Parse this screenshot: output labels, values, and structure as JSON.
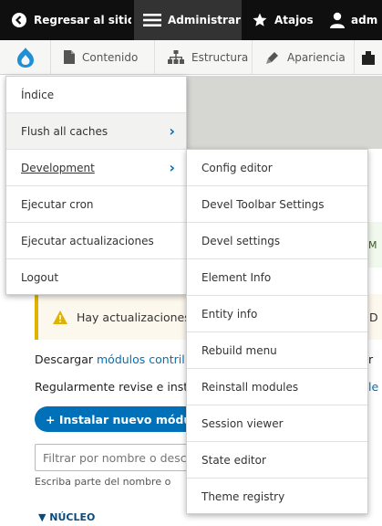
{
  "toolbar": {
    "back_label": "Regresar al sitio",
    "admin_label": "Administrar",
    "shortcuts_label": "Atajos",
    "user_label": "adm"
  },
  "tray": {
    "contenido": "Contenido",
    "estructura": "Estructura",
    "apariencia": "Apariencia"
  },
  "menu": {
    "items": [
      {
        "label": "Índice"
      },
      {
        "label": "Flush all caches"
      },
      {
        "label": "Development"
      },
      {
        "label": "Ejecutar cron"
      },
      {
        "label": "Ejecutar actualizaciones"
      },
      {
        "label": "Logout"
      }
    ]
  },
  "submenu": {
    "items": [
      {
        "label": "Config editor"
      },
      {
        "label": "Devel Toolbar Settings"
      },
      {
        "label": "Devel settings"
      },
      {
        "label": "Element Info"
      },
      {
        "label": "Entity info"
      },
      {
        "label": "Rebuild menu"
      },
      {
        "label": "Reinstall modules"
      },
      {
        "label": "Session viewer"
      },
      {
        "label": "State editor"
      },
      {
        "label": "Theme registry"
      }
    ]
  },
  "page": {
    "green_partial": "M",
    "warning_text": "Hay actualizaciones",
    "warning_tail": "D",
    "line1_prefix": "Descargar ",
    "line1_link": "módulos contril",
    "line1_tail": "r",
    "line2_prefix": "Regularmente revise e inst",
    "line2_tail": "le",
    "install_button": "+ Instalar nuevo módulo",
    "filter_placeholder": "Filtrar por nombre o desc",
    "filter_hint": "Escriba parte del nombre o",
    "section_label": "▼ NÚCLEO"
  },
  "colors": {
    "toolbar_bg": "#0f0f0f",
    "accent": "#0071b8",
    "warning": "#e0b300"
  }
}
